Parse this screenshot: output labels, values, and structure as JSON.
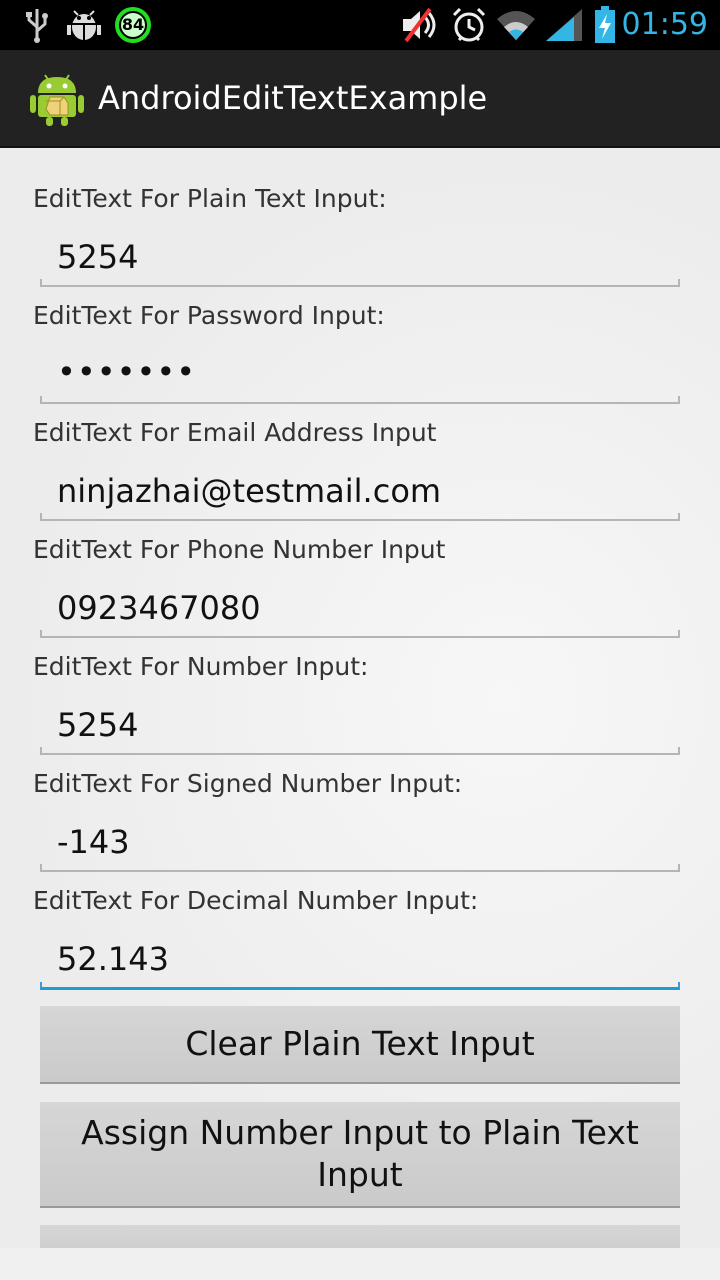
{
  "status_bar": {
    "icons": [
      "usb-icon",
      "android-debug-icon",
      "battery-level-badge-icon",
      "mute-icon",
      "alarm-icon",
      "wifi-icon",
      "signal-icon",
      "battery-charging-icon"
    ],
    "badge_value": "84",
    "time": "01:59",
    "accent_color": "#33b5e5"
  },
  "action_bar": {
    "title": "AndroidEditTextExample"
  },
  "fields": [
    {
      "label": "EditText For Plain Text Input:",
      "value": "5254"
    },
    {
      "label": "EditText For Password Input:",
      "value": "•••••••"
    },
    {
      "label": "EditText For Email Address Input",
      "value": "ninjazhai@testmail.com"
    },
    {
      "label": "EditText For Phone Number Input",
      "value": "0923467080"
    },
    {
      "label": "EditText For Number Input:",
      "value": "5254"
    },
    {
      "label": "EditText For Signed Number Input:",
      "value": "-143"
    },
    {
      "label": "EditText For Decimal Number Input:",
      "value": "52.143"
    }
  ],
  "buttons": {
    "clear_plain": "Clear Plain Text Input",
    "assign_number": "Assign Number Input to Plain Text Input"
  }
}
